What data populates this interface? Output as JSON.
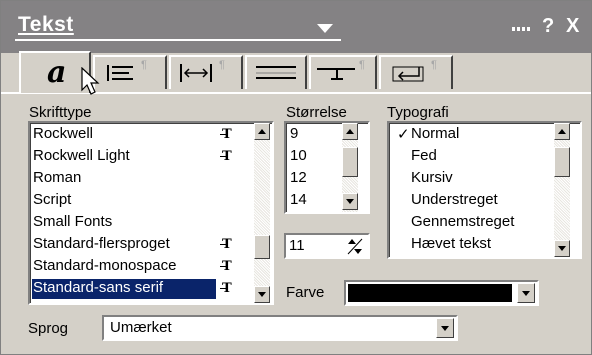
{
  "title": "Tekst",
  "tabs": [
    {
      "name": "character",
      "glyph": "a"
    },
    {
      "name": "paragraph",
      "glyph": "≡"
    },
    {
      "name": "spacing",
      "glyph": "|↔|"
    },
    {
      "name": "lines",
      "glyph": "═"
    },
    {
      "name": "tabs",
      "glyph": "┬"
    },
    {
      "name": "enter",
      "glyph": "↵"
    }
  ],
  "labels": {
    "font": "Skrifttype",
    "size": "Størrelse",
    "typography": "Typografi",
    "color": "Farve",
    "language": "Sprog"
  },
  "fonts": [
    {
      "name": "Rockwell",
      "truetype": true
    },
    {
      "name": "Rockwell Light",
      "truetype": true
    },
    {
      "name": "Roman",
      "truetype": false
    },
    {
      "name": "Script",
      "truetype": false
    },
    {
      "name": "Small Fonts",
      "truetype": false
    },
    {
      "name": "Standard-flersproget",
      "truetype": true
    },
    {
      "name": "Standard-monospace",
      "truetype": true
    },
    {
      "name": "Standard-sans serif",
      "truetype": true,
      "selected": true
    }
  ],
  "sizes": [
    "9",
    "10",
    "12",
    "14"
  ],
  "size_value": "11",
  "typography": [
    {
      "name": "Normal",
      "checked": true
    },
    {
      "name": "Fed"
    },
    {
      "name": "Kursiv"
    },
    {
      "name": "Understreget"
    },
    {
      "name": "Gennemstreget"
    },
    {
      "name": "Hævet tekst"
    }
  ],
  "check_mark": "✓",
  "color_value": "#000000",
  "language_value": "Umærket",
  "window_title_icons": {
    "help": "?",
    "close": "X"
  }
}
